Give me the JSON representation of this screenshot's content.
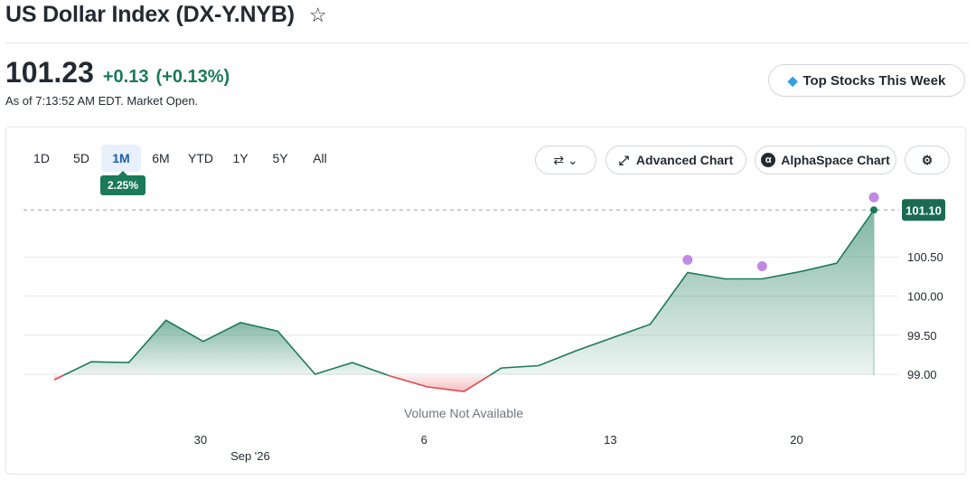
{
  "header": {
    "title": "US Dollar Index (DX-Y.NYB)",
    "price": "101.23",
    "change": "+0.13",
    "change_pct": "(+0.13%)",
    "as_of": "As of 7:13:52 AM EDT. Market Open.",
    "top_stocks": "Top Stocks This Week"
  },
  "ranges": [
    "1D",
    "5D",
    "1M",
    "6M",
    "YTD",
    "1Y",
    "5Y",
    "All"
  ],
  "active_range": "1M",
  "range_change": "2.25%",
  "toolbar": {
    "advanced": "Advanced Chart",
    "alpha": "AlphaSpace Chart"
  },
  "colors": {
    "up": "#1b7a5a",
    "down": "#e0474c",
    "marker": "#c08be0"
  },
  "chart_data": {
    "type": "area",
    "baseline": 98.99,
    "ylim": [
      98.7,
      101.3
    ],
    "y_ticks": [
      "99.00",
      "99.50",
      "100.00",
      "100.50"
    ],
    "x_ticks": [
      "30",
      "6",
      "13",
      "20"
    ],
    "x_sublabel": "Sep '26",
    "current_label": "101.10",
    "volume_note": "Volume Not Available",
    "values": [
      98.93,
      99.16,
      99.15,
      99.69,
      99.42,
      99.66,
      99.55,
      99.0,
      99.15,
      98.98,
      98.84,
      98.78,
      99.08,
      99.11,
      99.3,
      99.47,
      99.64,
      100.3,
      100.22,
      100.22,
      100.31,
      100.42,
      101.1
    ],
    "events": [
      17,
      19,
      22
    ]
  }
}
